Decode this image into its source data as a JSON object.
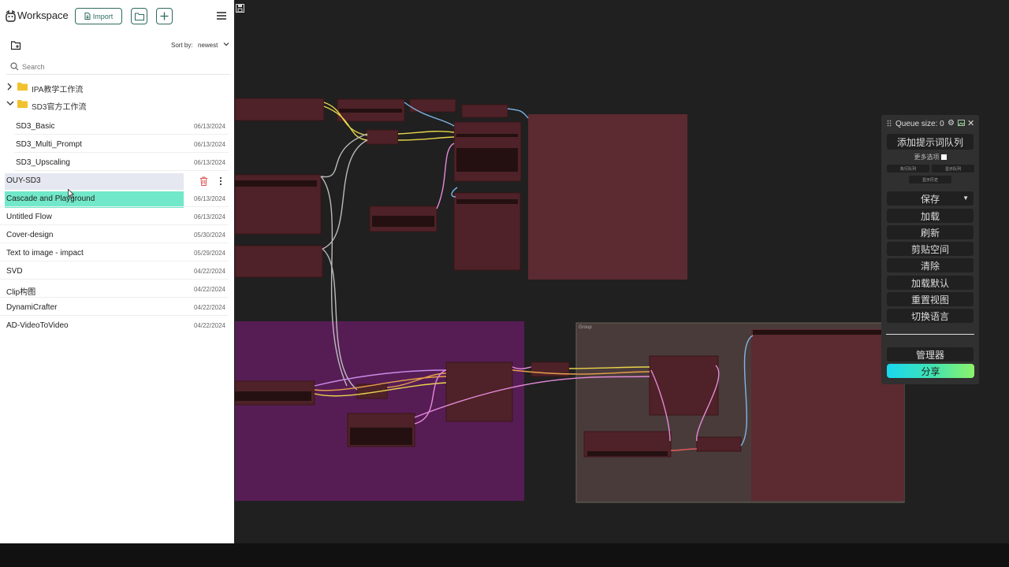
{
  "sidebar": {
    "app_title": "Workspace",
    "import_label": "Import",
    "sort_label": "Sort by:",
    "sort_value": "newest",
    "search_placeholder": "Search",
    "folders": [
      {
        "name": "IPA教学工作流",
        "expanded": false
      },
      {
        "name": "SD3官方工作流",
        "expanded": true
      }
    ],
    "folder_items": [
      {
        "name": "SD3_Basic",
        "date": "06/13/2024"
      },
      {
        "name": "SD3_Multi_Prompt",
        "date": "06/13/2024"
      },
      {
        "name": "SD3_Upscaling",
        "date": "06/13/2024"
      }
    ],
    "items": [
      {
        "name": "OUY-SD3",
        "date": ""
      },
      {
        "name": "Cascade and Playground",
        "date": "06/13/2024"
      },
      {
        "name": "Untitled Flow",
        "date": "06/13/2024"
      },
      {
        "name": "Cover-design",
        "date": "05/30/2024"
      },
      {
        "name": "Text to image - impact",
        "date": "05/29/2024"
      },
      {
        "name": "SVD",
        "date": "04/22/2024"
      },
      {
        "name": "Clip构图",
        "date": "04/22/2024"
      },
      {
        "name": "DynamiCrafter",
        "date": "04/22/2024"
      },
      {
        "name": "AD-VideoToVideo",
        "date": "04/22/2024"
      }
    ],
    "accent_color": "#2e6b5e",
    "active_color": "#71e8c9"
  },
  "canvas": {
    "group_label": "Group"
  },
  "queue_panel": {
    "queue_size": "Queue size: 0",
    "add_prompt_queue": "添加提示词队列",
    "more_options": "更多选项",
    "exec_queue": "执行队列",
    "show_queue": "显示队列",
    "show_history": "显示历史",
    "save": "保存",
    "load": "加载",
    "refresh": "刷新",
    "clipspace": "剪贴空间",
    "clear": "清除",
    "load_default": "加载默认",
    "reset_view": "重置视图",
    "switch_language": "切换语言",
    "manager": "管理器",
    "share": "分享"
  }
}
